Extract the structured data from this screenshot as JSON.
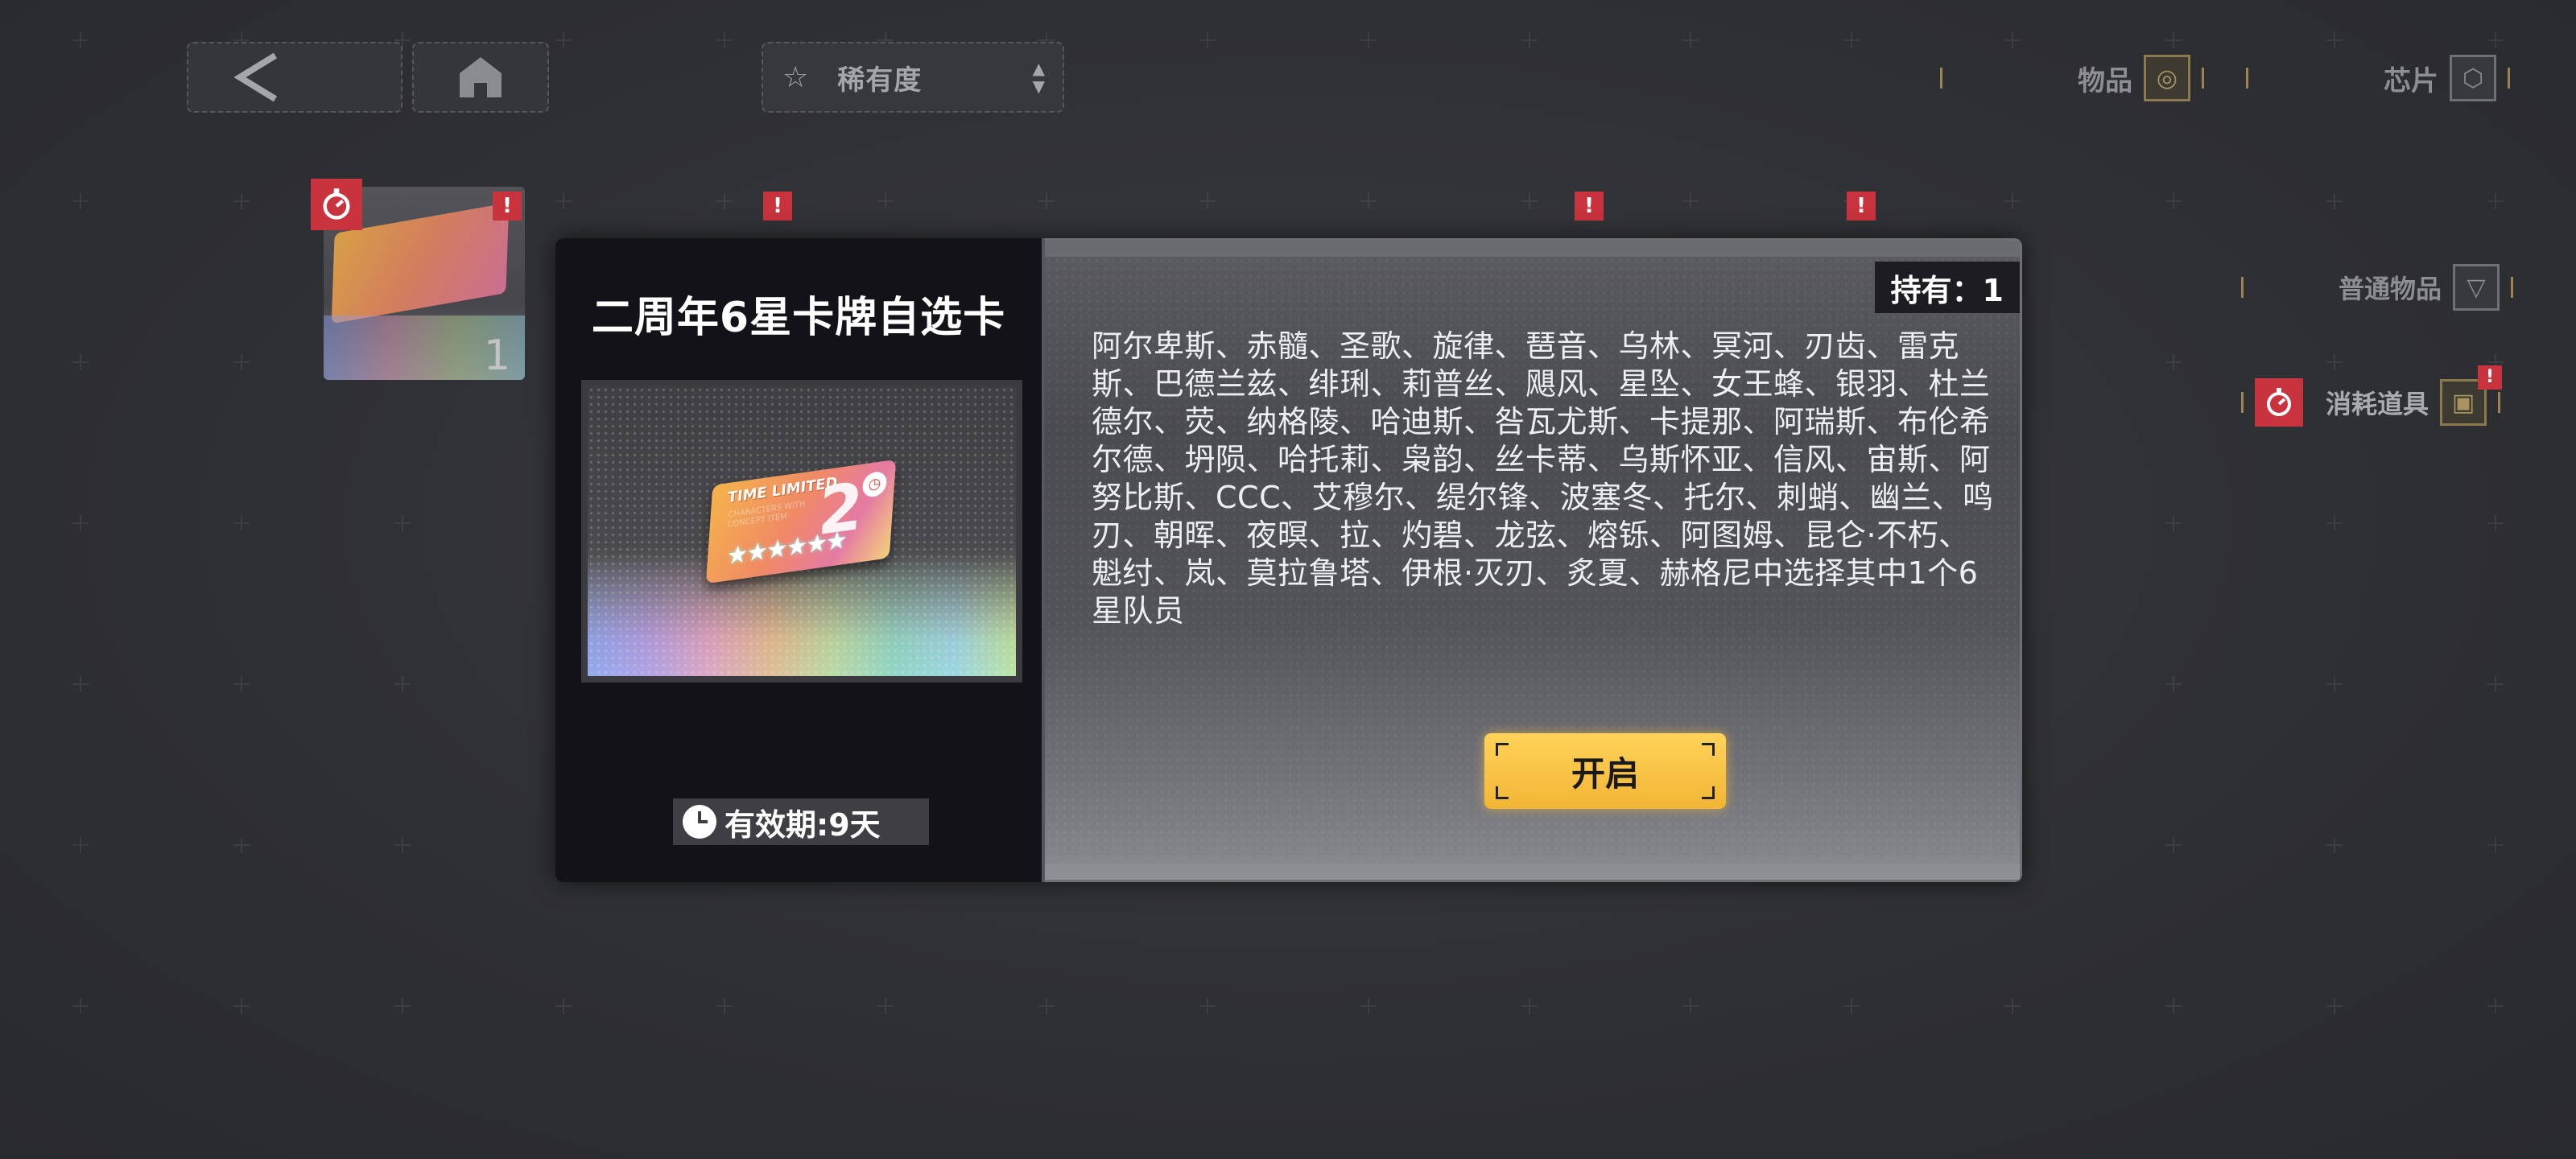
{
  "topbar": {
    "back_icon": "chevron-left-icon",
    "home_icon": "home-icon",
    "sort": {
      "star_icon": "☆",
      "label": "稀有度"
    }
  },
  "categories": {
    "items": {
      "label": "物品"
    },
    "chips": {
      "label": "芯片"
    },
    "normal": {
      "label": "普通物品"
    },
    "consumable": {
      "label": "消耗道具"
    }
  },
  "background_items": [
    {
      "count": "1",
      "badge": "!"
    },
    {
      "badge": "!"
    },
    {
      "badge": "!"
    },
    {
      "badge": "!"
    }
  ],
  "modal": {
    "title": "二周年6星卡牌自选卡",
    "held": "持有：1",
    "description": "阿尔卑斯、赤髓、圣歌、旋律、琶音、乌林、冥河、刃齿、雷克斯、巴德兰兹、绯琍、莉普丝、飓风、星坠、女王蜂、银羽、杜兰德尔、荧、纳格陵、哈迪斯、咎瓦尤斯、卡提那、阿瑞斯、布伦希尔德、坍陨、哈托莉、枭韵、丝卡蒂、乌斯怀亚、信风、宙斯、阿努比斯、CCC、艾穆尔、缇尔锋、波塞冬、托尔、刺蛸、幽兰、鸣刃、朝晖、夜暝、拉、灼碧、龙弦、熔铄、阿图姆、昆仑·不朽、魁纣、岚、莫拉鲁塔、伊根·灭刃、炙夏、赫格尼中选择其中1个6星队员",
    "validity": "有效期:9天",
    "open_button": "开启",
    "ticket": {
      "line1": "TIME LIMITED",
      "line2": "CHARACTERS WITH",
      "line3": "CONCEPT ITEM",
      "big": "2",
      "stars": "★★★★★★"
    }
  },
  "colors": {
    "accent_gold": "#f2b534",
    "alert_red": "#c8333d",
    "modal_dark": "#121218"
  }
}
